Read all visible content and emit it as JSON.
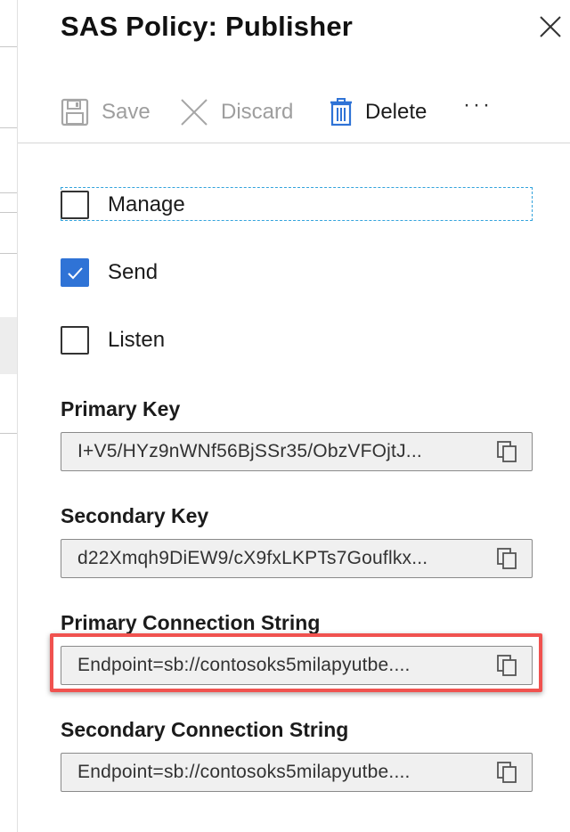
{
  "blade": {
    "title": "SAS Policy: Publisher"
  },
  "toolbar": {
    "save_label": "Save",
    "discard_label": "Discard",
    "delete_label": "Delete",
    "more_label": "···"
  },
  "claims": [
    {
      "label": "Manage",
      "checked": false
    },
    {
      "label": "Send",
      "checked": true
    },
    {
      "label": "Listen",
      "checked": false
    }
  ],
  "fields": {
    "primary_key": {
      "label": "Primary Key",
      "value": "I+V5/HYz9nWNf56BjSSr35/ObzVFOjtJ..."
    },
    "secondary_key": {
      "label": "Secondary Key",
      "value": "d22Xmqh9DiEW9/cX9fxLKPTs7Gouflkx..."
    },
    "primary_connection_string": {
      "label": "Primary Connection String",
      "value": "Endpoint=sb://contosoks5milapyutbe...."
    },
    "secondary_connection_string": {
      "label": "Secondary Connection String",
      "value": "Endpoint=sb://contosoks5milapyutbe...."
    }
  },
  "colors": {
    "accent": "#2f73d6",
    "highlight": "#f0524f",
    "focus_outline": "#33a3dc"
  },
  "icons": {
    "save": "save-icon",
    "discard": "discard-icon",
    "delete": "trash-icon",
    "copy": "copy-icon",
    "close": "close-icon",
    "checkmark": "checkmark-icon"
  }
}
